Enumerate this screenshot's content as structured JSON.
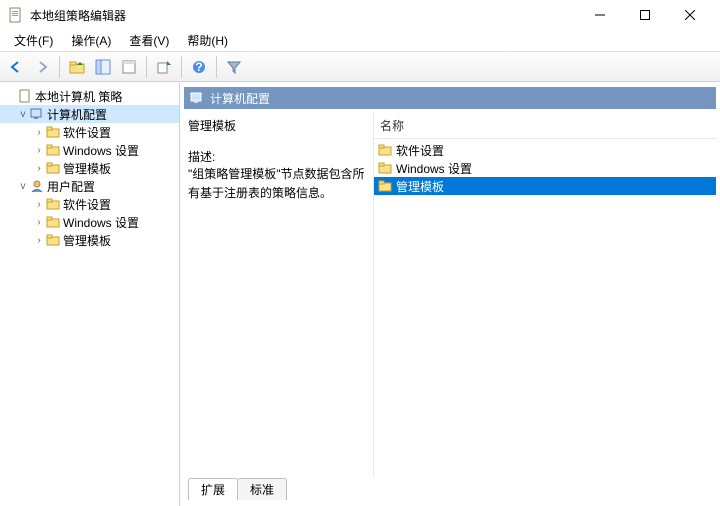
{
  "window": {
    "title": "本地组策略编辑器"
  },
  "menu": {
    "file": "文件(F)",
    "action": "操作(A)",
    "view": "查看(V)",
    "help": "帮助(H)"
  },
  "tree": {
    "root": "本地计算机 策略",
    "computer": "计算机配置",
    "c_software": "软件设置",
    "c_windows": "Windows 设置",
    "c_admin": "管理模板",
    "user": "用户配置",
    "u_software": "软件设置",
    "u_windows": "Windows 设置",
    "u_admin": "管理模板"
  },
  "header": {
    "title": "计算机配置"
  },
  "desc": {
    "title": "管理模板",
    "label": "描述:",
    "body": "\"组策略管理模板\"节点数据包含所有基于注册表的策略信息。"
  },
  "list": {
    "col_name": "名称",
    "items": [
      "软件设置",
      "Windows 设置",
      "管理模板"
    ],
    "selected_index": 2
  },
  "tabs": {
    "extended": "扩展",
    "standard": "标准"
  }
}
